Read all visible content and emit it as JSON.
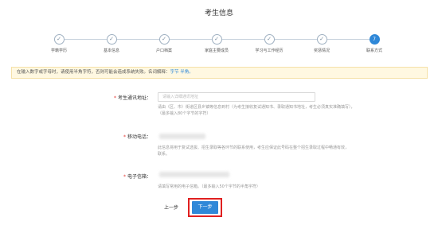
{
  "page": {
    "title": "考生信息"
  },
  "steps": [
    {
      "label": "学籍学历",
      "state": "done"
    },
    {
      "label": "基本信息",
      "state": "done"
    },
    {
      "label": "户口档案",
      "state": "done"
    },
    {
      "label": "家庭主要成员",
      "state": "done"
    },
    {
      "label": "学习与工作经历",
      "state": "done"
    },
    {
      "label": "奖惩情况",
      "state": "done"
    },
    {
      "label": "联系方式",
      "state": "active",
      "number": "7"
    }
  ],
  "notice": {
    "text": "在输入数字或字母时，请使用半角字符，否则可能会造成系统失败。名词解释：",
    "link_text": "字节 半角。"
  },
  "form": {
    "address": {
      "label": "考生通讯地址：",
      "placeholder": "请输入详细通讯地址",
      "hint_line1": "请由（区、市）街道区县乡镇等信息到村（为考生接收复试通知书、录取通知书地址，考生必须真实准确填写），",
      "hint_line2": "（最多输入80个字节的字符）"
    },
    "mobile": {
      "label": "移动电话：",
      "hint_line1": "此信息将用于复试选拔、招生录取等各环节的联系使用，考生应保证此号码在整个招生录取过程中畅通有效，",
      "hint_line2": "联系。"
    },
    "email": {
      "label": "电子信箱：",
      "hint": "请填写常用的电子信箱。（最多输入50个字节的半角字符）"
    }
  },
  "buttons": {
    "prev": "上一步",
    "next": "下一步"
  },
  "colors": {
    "accent": "#2f88d8",
    "highlight_frame": "#e02020",
    "required_star": "#e53935",
    "notice_bg": "#fff8e1"
  }
}
